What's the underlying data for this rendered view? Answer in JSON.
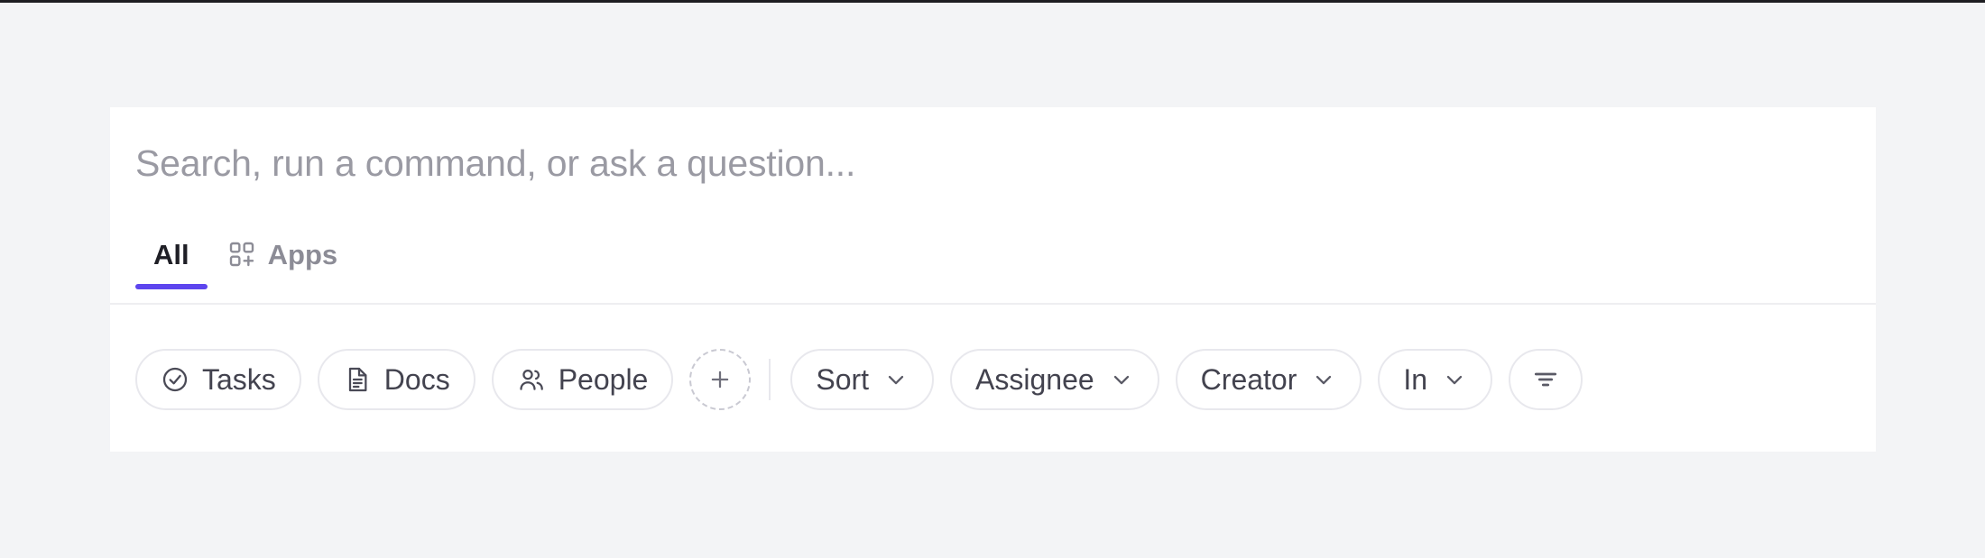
{
  "theme": {
    "page_background": "#f3f4f6",
    "panel_background": "#ffffff",
    "accent": "#5d45ee",
    "chip_border": "#e8e8ed",
    "placeholder_color": "#9a9aa3",
    "chip_text_color": "#43434f",
    "tab_active_color": "#1f1f26",
    "tab_inactive_color": "#8c8c96"
  },
  "search": {
    "value": "",
    "placeholder": "Search, run a command, or ask a question..."
  },
  "tabs": [
    {
      "label": "All",
      "icon": "",
      "active": true
    },
    {
      "label": "Apps",
      "icon": "apps-grid-plus-icon",
      "active": false
    }
  ],
  "filters": {
    "type_chips": [
      {
        "label": "Tasks",
        "icon": "check-circle-icon"
      },
      {
        "label": "Docs",
        "icon": "document-icon"
      },
      {
        "label": "People",
        "icon": "people-icon"
      }
    ],
    "add_chip": {
      "label": "",
      "icon": "plus-icon"
    },
    "dropdowns": [
      {
        "label": "Sort",
        "icon": "chevron-down-icon"
      },
      {
        "label": "Assignee",
        "icon": "chevron-down-icon"
      },
      {
        "label": "Creator",
        "icon": "chevron-down-icon"
      },
      {
        "label": "In",
        "icon": "chevron-down-icon"
      }
    ],
    "filter_button": {
      "label": "",
      "icon": "filter-lines-icon"
    }
  }
}
